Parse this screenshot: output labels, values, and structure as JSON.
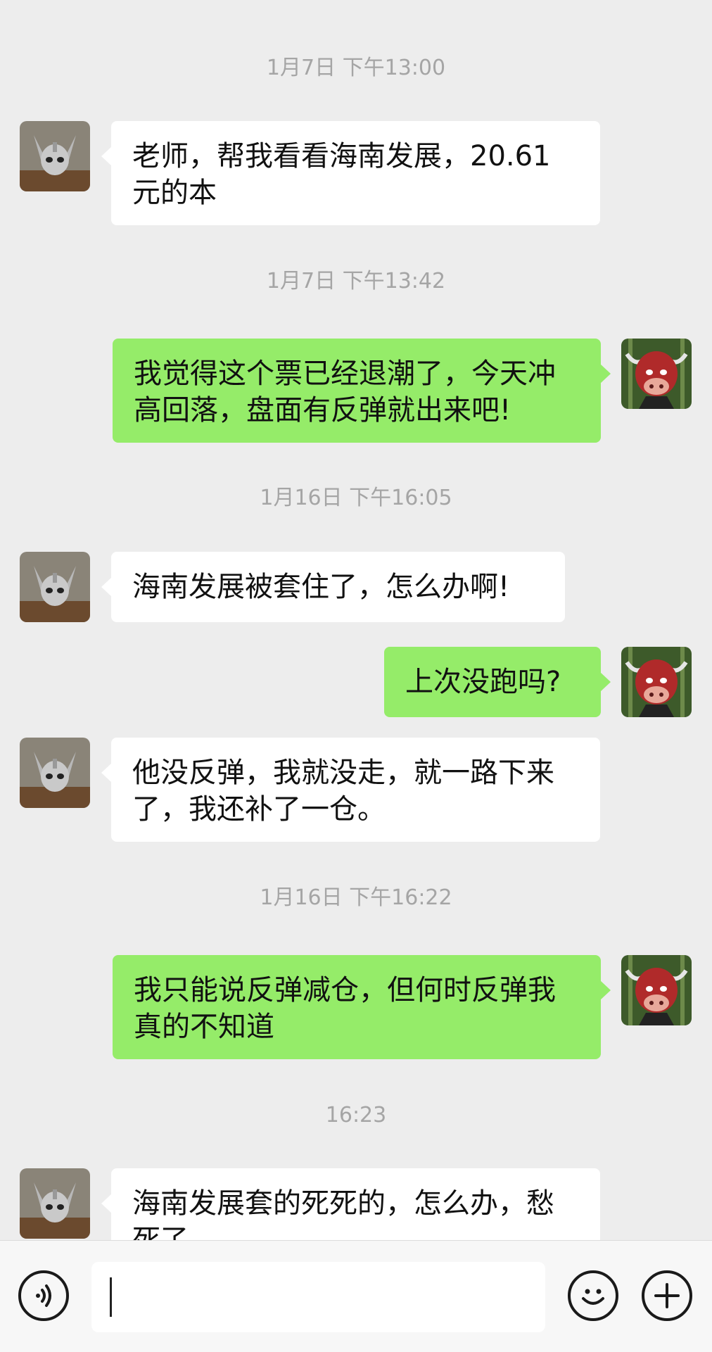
{
  "messages": {
    "ts1": "1月7日 下午13:00",
    "m1": "老师，帮我看看海南发展，20.61\n元的本",
    "ts2": "1月7日 下午13:42",
    "m2": "我觉得这个票已经退潮了，今天冲\n高回落，盘面有反弹就出来吧!",
    "ts3": "1月16日 下午16:05",
    "m3": "海南发展被套住了，怎么办啊!",
    "m4": "上次没跑吗?",
    "m5": "他没反弹，我就没走，就一路下来\n了，我还补了一仓。",
    "ts4": "1月16日 下午16:22",
    "m6": "我只能说反弹减仓，但何时反弹我\n真的不知道",
    "ts5": "16:23",
    "m7": "海南发展套的死死的，怎么办，愁\n死了"
  },
  "input_bar": {
    "voice_icon": "voice-icon",
    "emoji_icon": "emoji-icon",
    "add_icon": "plus-icon",
    "text_value": ""
  },
  "colors": {
    "background": "#ededed",
    "incoming_bubble": "#ffffff",
    "outgoing_bubble": "#95ec69",
    "timestamp": "#a5a5a5"
  }
}
